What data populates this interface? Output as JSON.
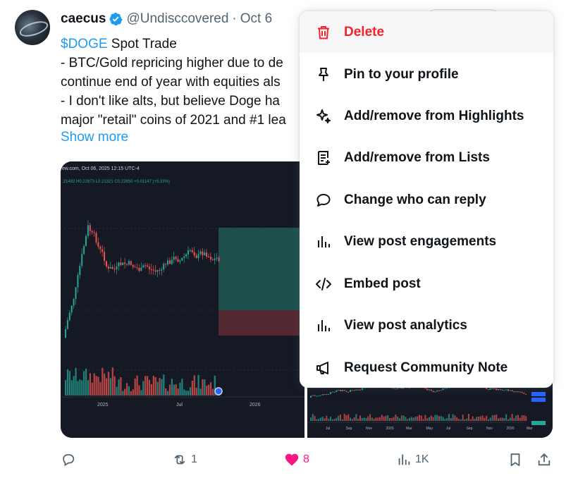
{
  "post": {
    "author_name": "caecus",
    "handle": "@Undisccovered",
    "separator": "·",
    "date": "Oct 6",
    "cashtag": "$DOGE",
    "line1_rest": " Spot Trade",
    "line2": "- BTC/Gold repricing higher due to de",
    "line3": "continue end of year with equities als",
    "line4": "- I don't like alts, but believe Doge ha",
    "line5": "major \"retail\" coins of 2021 and #1 lea",
    "show_more": "Show more"
  },
  "media": {
    "chart1_header": "ew.com, Oct 06, 2025 12:15 UTC-4",
    "chart1_ohlc": ".21492  H0.22873  L0.21321  C0.22650  +0.01147 (+5.33%)",
    "chart1_xlabels": [
      "2025",
      "Jul",
      "2026"
    ],
    "chart2_xlabels": [
      "Jul",
      "Sep",
      "Nov",
      "2025",
      "Mar",
      "May",
      "Jul",
      "Sep",
      "Nov",
      "2026",
      "Mar"
    ]
  },
  "actions": {
    "reply_count": "",
    "repost_count": "1",
    "like_count": "8",
    "views_count": "1K"
  },
  "menu": {
    "items": [
      {
        "label": "Delete",
        "icon": "trash-icon"
      },
      {
        "label": "Pin to your profile",
        "icon": "pin-icon"
      },
      {
        "label": "Add/remove from Highlights",
        "icon": "sparkle-icon"
      },
      {
        "label": "Add/remove from Lists",
        "icon": "list-icon"
      },
      {
        "label": "Change who can reply",
        "icon": "speech-bubble-icon"
      },
      {
        "label": "View post engagements",
        "icon": "bar-chart-icon"
      },
      {
        "label": "Embed post",
        "icon": "code-icon"
      },
      {
        "label": "View post analytics",
        "icon": "bar-chart-icon"
      },
      {
        "label": "Request Community Note",
        "icon": "megaphone-icon"
      }
    ]
  },
  "colors": {
    "accent": "#1d9bf0",
    "danger": "#f4212e",
    "like": "#f91880",
    "muted": "#536471",
    "chart_bg": "#151924",
    "candle_up": "#26a69a",
    "candle_down": "#ef5350"
  }
}
